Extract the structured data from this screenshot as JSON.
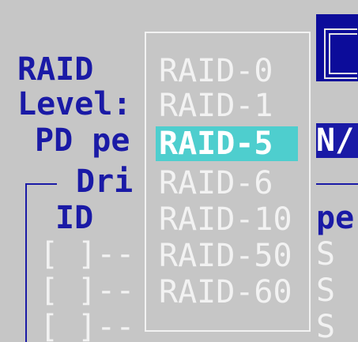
{
  "colors": {
    "background": "#c6c6c6",
    "label_text": "#1a1aa6",
    "dim_text": "#f2f2f2",
    "selection": "#4ecece",
    "window_dark": "#0c0c9a"
  },
  "labels": {
    "raid": "RAID",
    "level": "Level:",
    "pd_pe": "PD pe",
    "dri": "Dri",
    "id": "ID",
    "row_bracket": "[ ]--",
    "na": "N/",
    "pe": "pe",
    "s": "S"
  },
  "dropdown": {
    "selected": "RAID-5",
    "options": [
      "RAID-0",
      "RAID-1",
      "RAID-5",
      "RAID-6",
      "RAID-10",
      "RAID-50",
      "RAID-60"
    ]
  }
}
